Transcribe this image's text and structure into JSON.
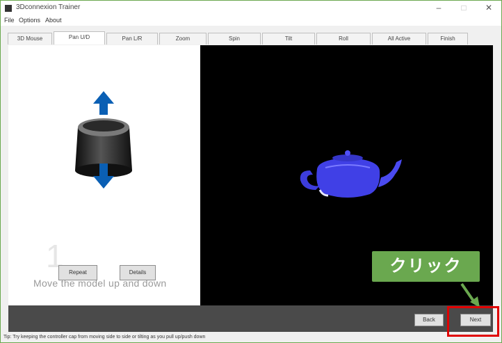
{
  "window": {
    "title": "3Dconnexion Trainer",
    "minimize_glyph": "–",
    "maximize_glyph": "□",
    "close_glyph": "✕"
  },
  "menu": [
    "File",
    "Options",
    "About"
  ],
  "tabs": [
    "3D Mouse",
    "Pan U/D",
    "Pan L/R",
    "Zoom",
    "Spin",
    "Tilt",
    "Roll",
    "All Active",
    "Finish"
  ],
  "active_tab_index": 1,
  "lesson": {
    "step": "1",
    "instruction": "Move the model up and down",
    "buttons": {
      "repeat": "Repeat",
      "details": "Details"
    }
  },
  "navigation": {
    "back": "Back",
    "next": "Next"
  },
  "status_text": "Tip: Try keeping the controller cap from moving side to side or tilting as you pull up/push down",
  "callout": {
    "text": "クリック"
  },
  "icons": [
    "app-icon",
    "up-arrow-icon",
    "down-arrow-icon",
    "controller-cap-icon",
    "teapot-model",
    "pointer-arrow-icon"
  ],
  "colors": {
    "arrow": "#0a5fb4",
    "callout": "#6aa84f",
    "highlight": "#e00000",
    "teapot": "#3d3ddc",
    "canvas": "#000000"
  }
}
